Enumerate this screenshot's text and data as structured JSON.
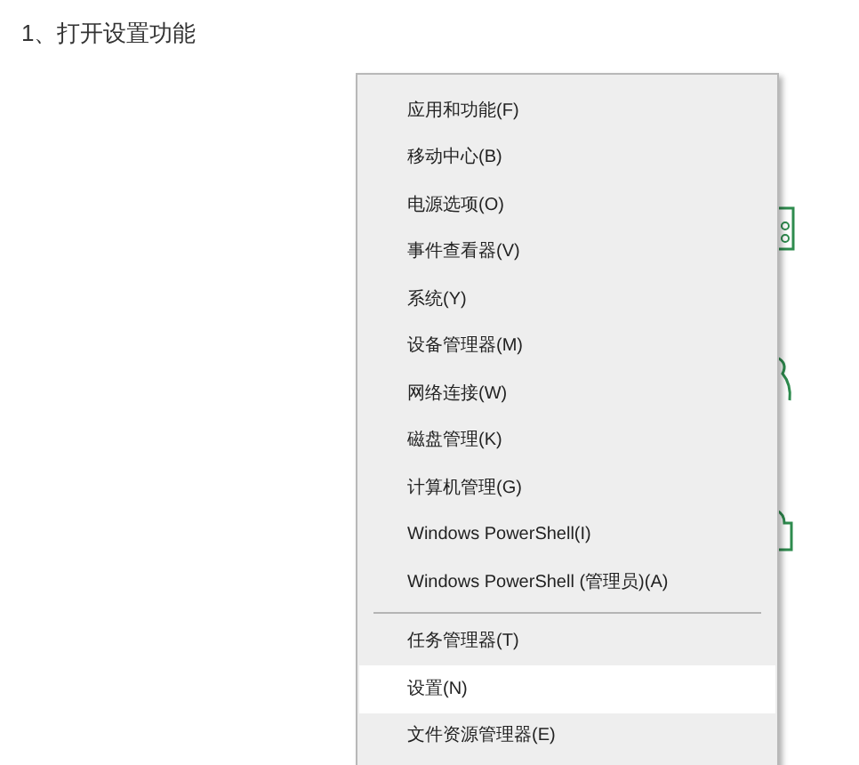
{
  "heading": "1、打开设置功能",
  "menu": {
    "items": [
      {
        "kind": "item",
        "label": "应用和功能(F)",
        "selected": false
      },
      {
        "kind": "item",
        "label": "移动中心(B)",
        "selected": false
      },
      {
        "kind": "item",
        "label": "电源选项(O)",
        "selected": false
      },
      {
        "kind": "item",
        "label": "事件查看器(V)",
        "selected": false
      },
      {
        "kind": "item",
        "label": "系统(Y)",
        "selected": false
      },
      {
        "kind": "item",
        "label": "设备管理器(M)",
        "selected": false
      },
      {
        "kind": "item",
        "label": "网络连接(W)",
        "selected": false
      },
      {
        "kind": "item",
        "label": "磁盘管理(K)",
        "selected": false
      },
      {
        "kind": "item",
        "label": "计算机管理(G)",
        "selected": false
      },
      {
        "kind": "item",
        "label": "Windows PowerShell(I)",
        "selected": false
      },
      {
        "kind": "item",
        "label": "Windows PowerShell (管理员)(A)",
        "selected": false
      },
      {
        "kind": "separator"
      },
      {
        "kind": "item",
        "label": "任务管理器(T)",
        "selected": false
      },
      {
        "kind": "item",
        "label": "设置(N)",
        "selected": true
      },
      {
        "kind": "item",
        "label": "文件资源管理器(E)",
        "selected": false
      }
    ]
  }
}
